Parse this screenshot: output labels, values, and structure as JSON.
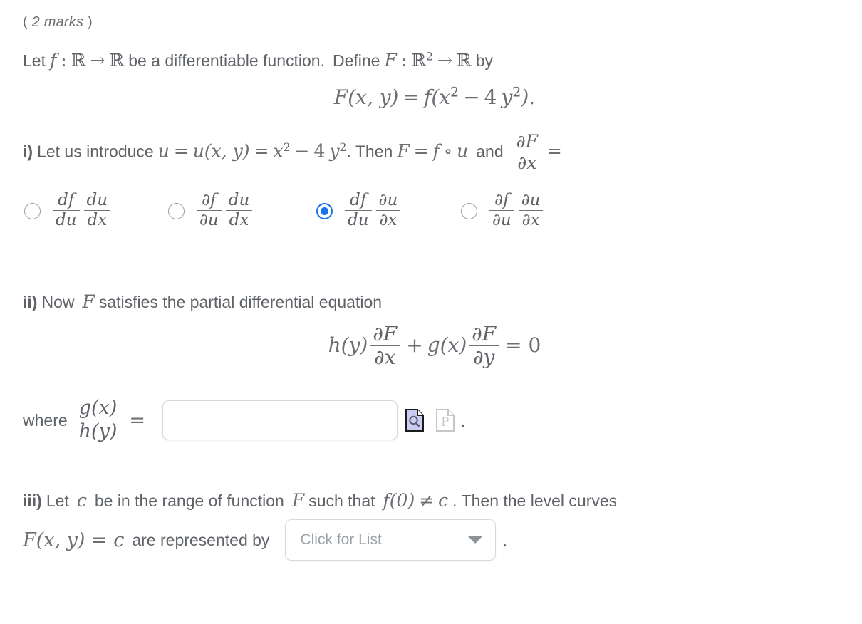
{
  "header": {
    "marks": "2 marks",
    "open_paren": "(",
    "close_paren": ")"
  },
  "intro": {
    "text_let": "Let",
    "f": "f",
    "colon": ":",
    "reals": "ℝ",
    "arrow": "→",
    "text_be": "be a differentiable function.",
    "text_define": "Define",
    "F": "F",
    "reals_sq_base": "ℝ",
    "reals_sq_exp": "2",
    "text_by": "by"
  },
  "display_formula_1": {
    "lhs": "F(x, y)",
    "equals": "=",
    "rhs_prefix": "f(x",
    "exp1": "2",
    "minus": "−",
    "four": "4",
    "y": "y",
    "exp2": "2",
    "rhs_suffix": ").",
    "plain": "F(x, y) = f(x² − 4 y²)."
  },
  "part_i": {
    "label": "i)",
    "text_1": "Let us introduce",
    "u": "u",
    "eq": "=",
    "u_xy": "u(x, y)",
    "eq2": "=",
    "x": "x",
    "exp_x": "2",
    "minus": "−",
    "four": "4",
    "y": "y",
    "exp_y": "2",
    "period": ".",
    "text_2": "Then",
    "F": "F",
    "eq3": "=",
    "f": "f",
    "compose": "∘",
    "u2": "u",
    "text_and": "and",
    "deriv_num": "∂F",
    "deriv_den": "∂x",
    "eq4": "=",
    "options": [
      {
        "id": "option-a",
        "selected": false,
        "frac1_num": "df",
        "frac1_den": "du",
        "frac2_num": "du",
        "frac2_den": "dx"
      },
      {
        "id": "option-b",
        "selected": false,
        "frac1_num": "∂f",
        "frac1_den": "∂u",
        "frac2_num": "du",
        "frac2_den": "dx"
      },
      {
        "id": "option-c",
        "selected": true,
        "frac1_num": "df",
        "frac1_den": "du",
        "frac2_num": "∂u",
        "frac2_den": "∂x"
      },
      {
        "id": "option-d",
        "selected": false,
        "frac1_num": "∂f",
        "frac1_den": "∂u",
        "frac2_num": "∂u",
        "frac2_den": "∂x"
      }
    ]
  },
  "part_ii": {
    "label": "ii)",
    "text_1": "Now",
    "F": "F",
    "text_2": "satisfies the partial differential equation",
    "equation": {
      "h_of_y": "h(y)",
      "frac1_num": "∂F",
      "frac1_den": "∂x",
      "plus": "+",
      "g_of_x": "g(x)",
      "frac2_num": "∂F",
      "frac2_den": "∂y",
      "equals": "= 0",
      "plain": "h(y) ∂F/∂x + g(x) ∂F/∂y = 0"
    },
    "where_label": "where",
    "where_frac_num": "g(x)",
    "where_frac_den": "h(y)",
    "where_equals": "=",
    "answer_value": "",
    "answer_placeholder": "",
    "preview_icon": "document-magnifier-icon",
    "palette_icon": "document-p-icon",
    "trailing_dot": "."
  },
  "part_iii": {
    "label": "iii)",
    "text_1": "Let",
    "c": "c",
    "text_2": "be in the range of function",
    "F": "F",
    "text_3": "such that",
    "f_zero": "f(0)",
    "neq": "≠",
    "c2": "c",
    "period": ".",
    "text_4": "Then the level curves",
    "level_eq": "F(x, y) = c",
    "text_5": "are represented by",
    "dropdown_value": "Click for List",
    "trailing_dot": "."
  },
  "colors": {
    "text": "#5f6368",
    "math": "#6b6f73",
    "accent_selected": "#1a73e8",
    "radio_border": "#9aa0a6",
    "field_border": "#d8d8d8",
    "placeholder": "#9aa0a6",
    "icon_active_fill": "#ccccf2",
    "icon_disabled": "#c6c6c6"
  }
}
